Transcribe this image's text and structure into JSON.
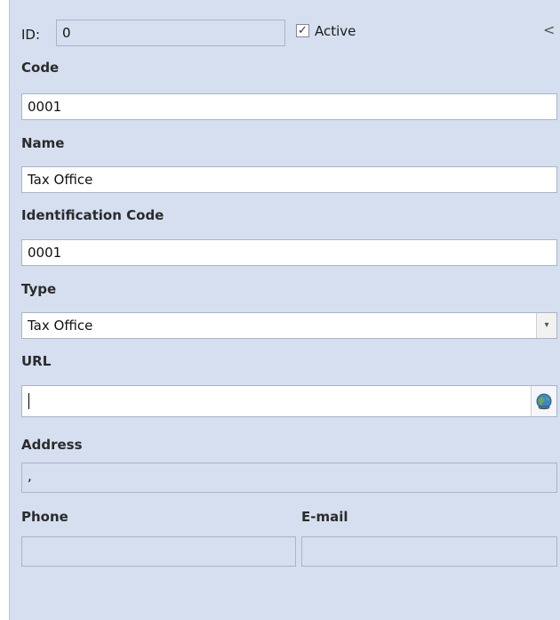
{
  "header": {
    "id_label": "ID:",
    "id_value": "0",
    "active_label": "Active",
    "active_checked": true,
    "collapse_glyph": "<"
  },
  "code": {
    "label": "Code",
    "value": "0001"
  },
  "name": {
    "label": "Name",
    "value": "Tax Office"
  },
  "identification_code": {
    "label": "Identification Code",
    "value": "0001"
  },
  "type": {
    "label": "Type",
    "value": "Tax Office",
    "dropdown_glyph": "▾"
  },
  "url": {
    "label": "URL",
    "value": ""
  },
  "address": {
    "label": "Address",
    "value": ","
  },
  "phone": {
    "label": "Phone",
    "value": ""
  },
  "email": {
    "label": "E-mail",
    "value": ""
  },
  "icons": {
    "globe": "globe-icon",
    "checkbox": "check-icon"
  },
  "colors": {
    "panel_bg": "#d5dfef",
    "field_border": "#a9b4c4"
  }
}
